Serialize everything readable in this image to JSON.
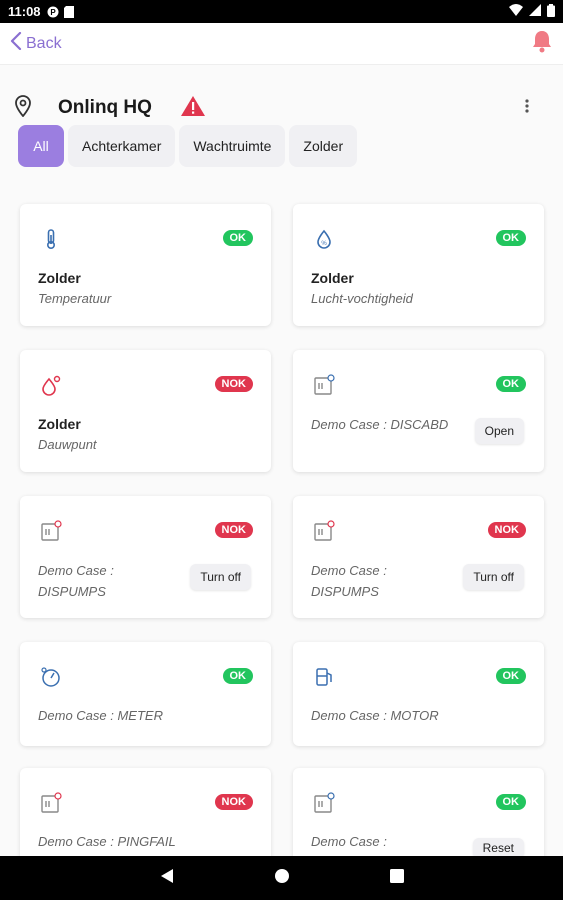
{
  "status_bar": {
    "time": "11:08"
  },
  "app_bar": {
    "back_label": "Back"
  },
  "location": {
    "title": "Onlinq HQ"
  },
  "filters": [
    "All",
    "Achterkamer",
    "Wachtruimte",
    "Zolder"
  ],
  "cards": [
    {
      "icon": "thermometer-icon",
      "status": "OK",
      "name": "Zolder",
      "subtitle": "Temperatuur"
    },
    {
      "icon": "humidity-drop-icon",
      "status": "OK",
      "name": "Zolder",
      "subtitle": "Lucht-vochtigheid"
    },
    {
      "icon": "dewpoint-icon",
      "status": "NOK",
      "name": "Zolder",
      "subtitle": "Dauwpunt"
    },
    {
      "icon": "device-icon",
      "status": "OK",
      "description_line1": "Demo Case : DISCABD",
      "action": "Open"
    },
    {
      "icon": "device-alert-icon",
      "status": "NOK",
      "description_line1": "Demo Case :",
      "description_line2": "DISPUMPS",
      "action": "Turn off"
    },
    {
      "icon": "device-alert-icon",
      "status": "NOK",
      "description_line1": "Demo Case :",
      "description_line2": "DISPUMPS",
      "action": "Turn off"
    },
    {
      "icon": "meter-icon",
      "status": "OK",
      "description_line1": "Demo Case : METER"
    },
    {
      "icon": "motor-icon",
      "status": "OK",
      "description_line1": "Demo Case : MOTOR"
    },
    {
      "icon": "device-alert-icon",
      "status": "NOK",
      "description_line1": "Demo Case : PINGFAIL"
    },
    {
      "icon": "device-icon",
      "status": "OK",
      "description_line1": "Demo Case :",
      "action": "Reset"
    }
  ],
  "colors": {
    "accent": "#9b7ee0",
    "ok": "#22c55e",
    "nok": "#e0364e",
    "bell": "#f07a84",
    "alert": "#e0364e"
  }
}
